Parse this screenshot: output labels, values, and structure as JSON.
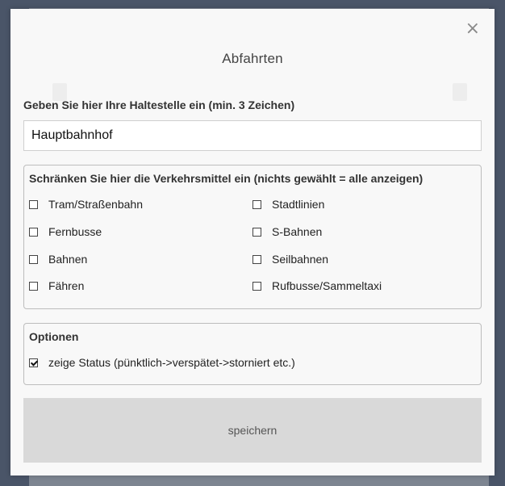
{
  "dialog": {
    "title": "Abfahrten",
    "close_symbol": "×",
    "stop_label": "Geben Sie hier Ihre Haltestelle ein (min. 3 Zeichen)",
    "stop_value": "Hauptbahnhof"
  },
  "transport": {
    "title": "Schränken Sie hier die Verkehrsmittel ein (nichts gewählt = alle anzeigen)",
    "left": [
      {
        "label": "Tram/Straßenbahn",
        "checked": false
      },
      {
        "label": "Fernbusse",
        "checked": false
      },
      {
        "label": "Bahnen",
        "checked": false
      },
      {
        "label": "Fähren",
        "checked": false
      }
    ],
    "right": [
      {
        "label": "Stadtlinien",
        "checked": false
      },
      {
        "label": "S-Bahnen",
        "checked": false
      },
      {
        "label": "Seilbahnen",
        "checked": false
      },
      {
        "label": "Rufbusse/Sammeltaxi",
        "checked": false
      }
    ]
  },
  "options": {
    "title": "Optionen",
    "status": {
      "label": "zeige Status (pünktlich->verspätet->storniert etc.)",
      "checked": true
    }
  },
  "actions": {
    "save_label": "speichern"
  }
}
